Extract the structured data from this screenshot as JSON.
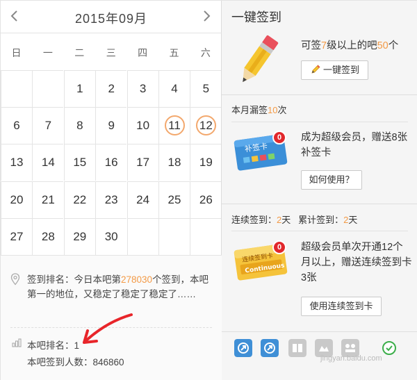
{
  "calendar": {
    "title": "2015年09月",
    "prev_icon": "‹",
    "next_icon": "›",
    "weekdays": [
      "日",
      "一",
      "二",
      "三",
      "四",
      "五",
      "六"
    ],
    "weeks": [
      [
        "",
        "",
        "1",
        "2",
        "3",
        "4",
        "5"
      ],
      [
        "6",
        "7",
        "8",
        "9",
        "10",
        "11",
        "12"
      ],
      [
        "13",
        "14",
        "15",
        "16",
        "17",
        "18",
        "19"
      ],
      [
        "20",
        "21",
        "22",
        "23",
        "24",
        "25",
        "26"
      ],
      [
        "27",
        "28",
        "29",
        "30",
        "",
        "",
        ""
      ]
    ],
    "signed_days": [
      "11",
      "12"
    ],
    "signed_ring_color": "#f3a86d"
  },
  "info": {
    "rank_prefix": "签到排名：今日本吧第",
    "rank_number": "278030",
    "rank_suffix": "个签到，本吧第一的地位，又稳定了稳定了稳定了……",
    "bar_rank_label": "本吧排名：1",
    "sign_count_label": "本吧签到人数：846860"
  },
  "quick_sign": {
    "title": "一键签到",
    "desc_prefix": "可签",
    "desc_level": "7",
    "desc_middle": "级以上的吧",
    "desc_count": "50",
    "desc_suffix": "个",
    "button_label": "一键签到"
  },
  "missed": {
    "prefix": "本月漏签",
    "count": "10",
    "suffix": "次"
  },
  "makeup_card": {
    "badge": "0",
    "card_text": "补签卡",
    "desc": "成为超级会员，赠送8张补签卡",
    "button_label": "如何使用？"
  },
  "streak": {
    "continuous_label": "连续签到：",
    "continuous_value": "2",
    "continuous_unit": "天",
    "total_label": "累计签到：",
    "total_value": "2",
    "total_unit": "天"
  },
  "continuous_card": {
    "badge": "0",
    "card_text": "连续签到卡",
    "card_subtext": "Continuous",
    "desc": "超级会员单次开通12个月以上，赠送连续签到卡3张",
    "button_label": "使用连续签到卡"
  },
  "footer": {
    "watermark": "jingyan.baidu.com"
  },
  "colors": {
    "accent": "#f39a46",
    "badge_red": "#e1272b",
    "card_blue": "#3b8fd8",
    "card_yellow": "#f5c33b",
    "icon_blue": "#3f8fd6"
  }
}
